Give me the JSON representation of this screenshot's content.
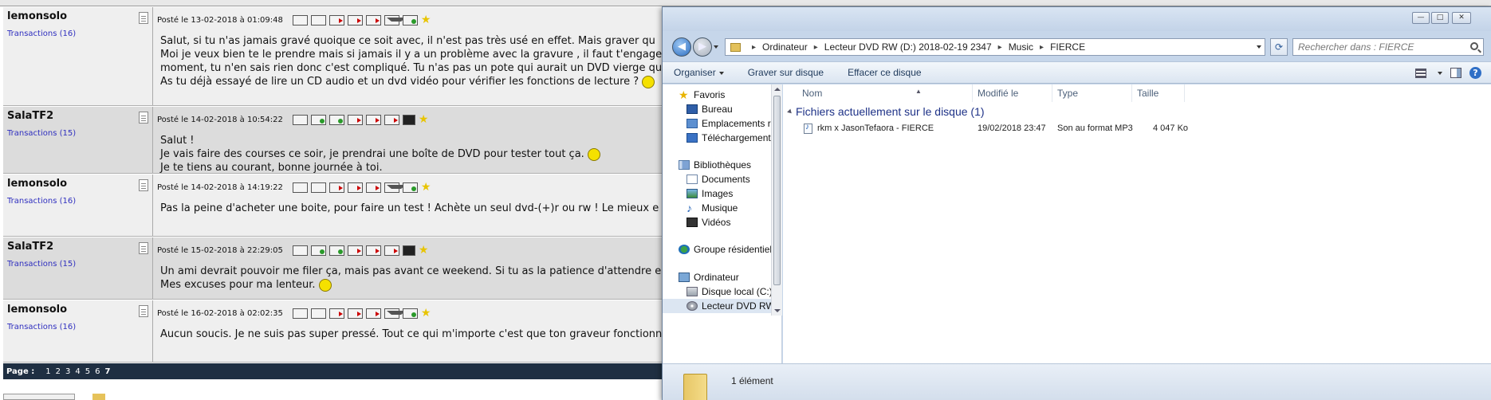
{
  "forum": {
    "posts": [
      {
        "author": "lemonsolo",
        "transactions": "Transactions (16)",
        "date": "Posté le 13-02-2018 à 01:09:48",
        "lines": [
          "Salut, si tu n'as jamais gravé quoique ce soit avec, il n'est pas très usé en effet. Mais graver qu",
          "Moi je veux bien te le prendre mais si jamais il y a un problème avec la gravure , il faut t'engage",
          "moment, tu n'en sais rien donc c'est compliqué. Tu n'as pas un pote qui aurait un DVD vierge qu",
          "As tu déjà essayé de lire un CD audio et un dvd vidéo pour vérifier les fonctions de lecture ?"
        ]
      },
      {
        "author": "SalaTF2",
        "transactions": "Transactions (15)",
        "date": "Posté le 14-02-2018 à 10:54:22",
        "lines": [
          "Salut !",
          "Je vais faire des courses ce soir, je prendrai une boîte de DVD pour tester tout ça.",
          "Je te tiens au courant, bonne journée à toi."
        ]
      },
      {
        "author": "lemonsolo",
        "transactions": "Transactions (16)",
        "date": "Posté le 14-02-2018 à 14:19:22",
        "lines": [
          "Pas la peine d'acheter une boite, pour faire un test ! Achète un seul dvd-(+)r ou rw  ! Le mieux e"
        ]
      },
      {
        "author": "SalaTF2",
        "transactions": "Transactions (15)",
        "date": "Posté le 15-02-2018 à 22:29:05",
        "lines": [
          "Un ami devrait pouvoir me filer ça, mais pas avant ce weekend. Si tu as la patience d'attendre e",
          "Mes excuses pour ma lenteur."
        ]
      },
      {
        "author": "lemonsolo",
        "transactions": "Transactions (16)",
        "date": "Posté le 16-02-2018 à 02:02:35",
        "lines": [
          "Aucun soucis. Je ne suis pas super pressé. Tout ce qui m'importe c'est que ton graveur fonctionn"
        ]
      }
    ],
    "pagination": {
      "label": "Page :",
      "pages": [
        "1",
        "2",
        "3",
        "4",
        "5",
        "6",
        "7"
      ]
    }
  },
  "explorer": {
    "window_buttons": {
      "minimize": "—",
      "maximize": "□",
      "close": "✕"
    },
    "breadcrumb": [
      "Ordinateur",
      "Lecteur DVD RW (D:) 2018-02-19 2347",
      "Music",
      "FIERCE"
    ],
    "breadcrumb_separator": "▸",
    "search_placeholder": "Rechercher dans : FIERCE",
    "toolbar": {
      "organize": "Organiser",
      "burn": "Graver sur disque",
      "erase": "Effacer ce disque"
    },
    "nav": {
      "favorites": "Favoris",
      "desktop": "Bureau",
      "recent_places": "Emplacements ré",
      "downloads": "Téléchargements",
      "libraries": "Bibliothèques",
      "documents": "Documents",
      "images": "Images",
      "music": "Musique",
      "videos": "Vidéos",
      "homegroup": "Groupe résidentiel",
      "computer": "Ordinateur",
      "local_disk": "Disque local (C:)",
      "dvd_drive": "Lecteur DVD RW"
    },
    "columns": {
      "name": "Nom",
      "modified": "Modifié le",
      "type": "Type",
      "size": "Taille"
    },
    "group_header": "Fichiers actuellement sur le disque (1)",
    "files": [
      {
        "name": "rkm x JasonTefaora - FIERCE",
        "modified": "19/02/2018 23:47",
        "type": "Son au format MP3",
        "size": "4 047 Ko"
      }
    ],
    "status": "1 élément"
  }
}
